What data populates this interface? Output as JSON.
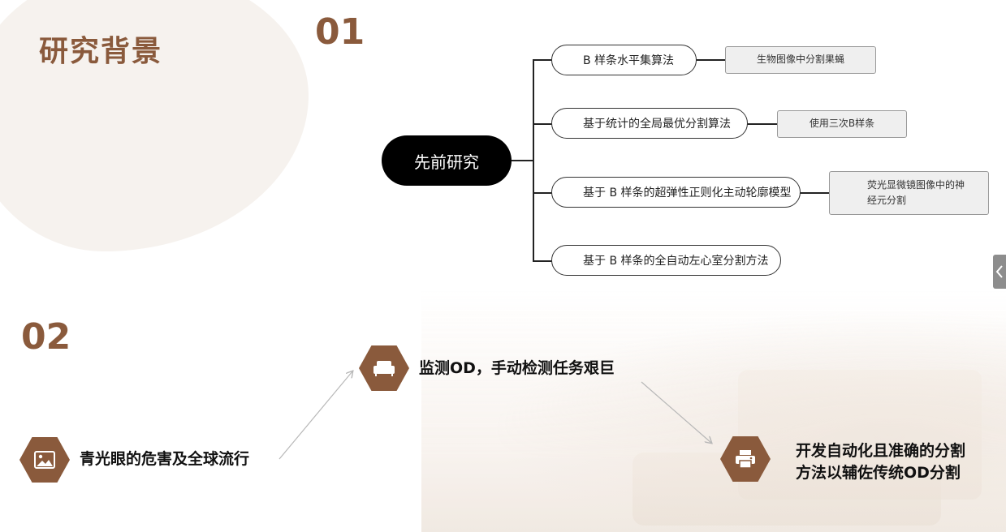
{
  "header": {
    "title": "研究背景"
  },
  "section1": {
    "number": "01"
  },
  "section2": {
    "number": "02"
  },
  "mindmap": {
    "root": "先前研究",
    "branches": [
      {
        "label": "B 样条水平集算法",
        "note": "生物图像中分割果蝇"
      },
      {
        "label": "基于统计的全局最优分割算法",
        "note": "使用三次B样条"
      },
      {
        "label": "基于 B 样条的超弹性正则化主动轮廓模型",
        "note_line1": "荧光显微镜图像中的神",
        "note_line2": "经元分割"
      },
      {
        "label": "基于 B 样条的全自动左心室分割方法"
      }
    ]
  },
  "flow": {
    "step1": {
      "label": "青光眼的危害及全球流行",
      "icon": "image-icon"
    },
    "step2": {
      "label": "监测OD，手动检测任务艰巨",
      "icon": "sofa-icon"
    },
    "step3": {
      "line1": "开发自动化且准确的分割",
      "line2": "方法以辅佐传统OD分割",
      "icon": "printer-icon"
    }
  },
  "colors": {
    "accent": "#8a5a3c",
    "root_fill": "#000000",
    "note_fill": "#efefef"
  }
}
